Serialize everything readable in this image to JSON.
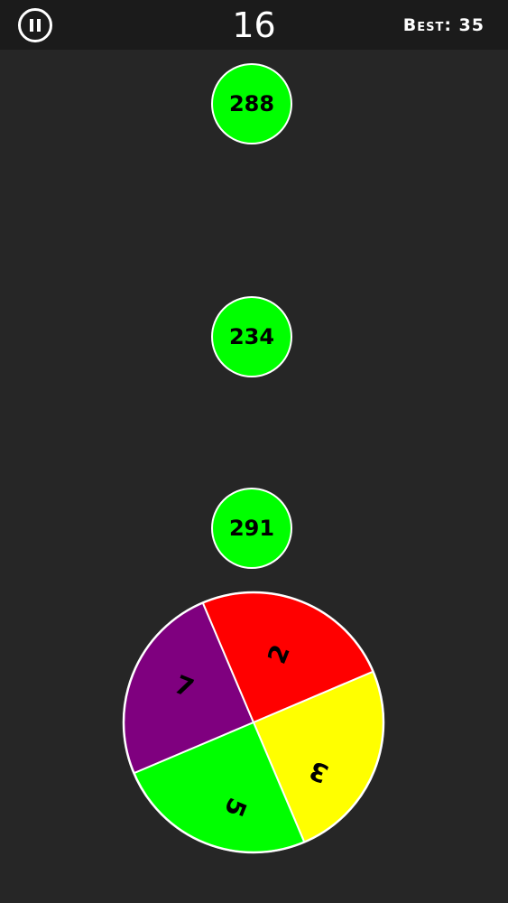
{
  "hud": {
    "score": "16",
    "best": "Best: 35",
    "pause_icon": "pause-icon"
  },
  "balls": [
    {
      "value": "288",
      "color": "#00ff00"
    },
    {
      "value": "234",
      "color": "#00ff00"
    },
    {
      "value": "291",
      "color": "#00ff00"
    }
  ],
  "wheel": {
    "segments": [
      {
        "value": "7",
        "color": "#7f007f"
      },
      {
        "value": "2",
        "color": "#ff0000"
      },
      {
        "value": "3",
        "color": "#ffff00"
      },
      {
        "value": "5",
        "color": "#00ff00"
      }
    ]
  }
}
